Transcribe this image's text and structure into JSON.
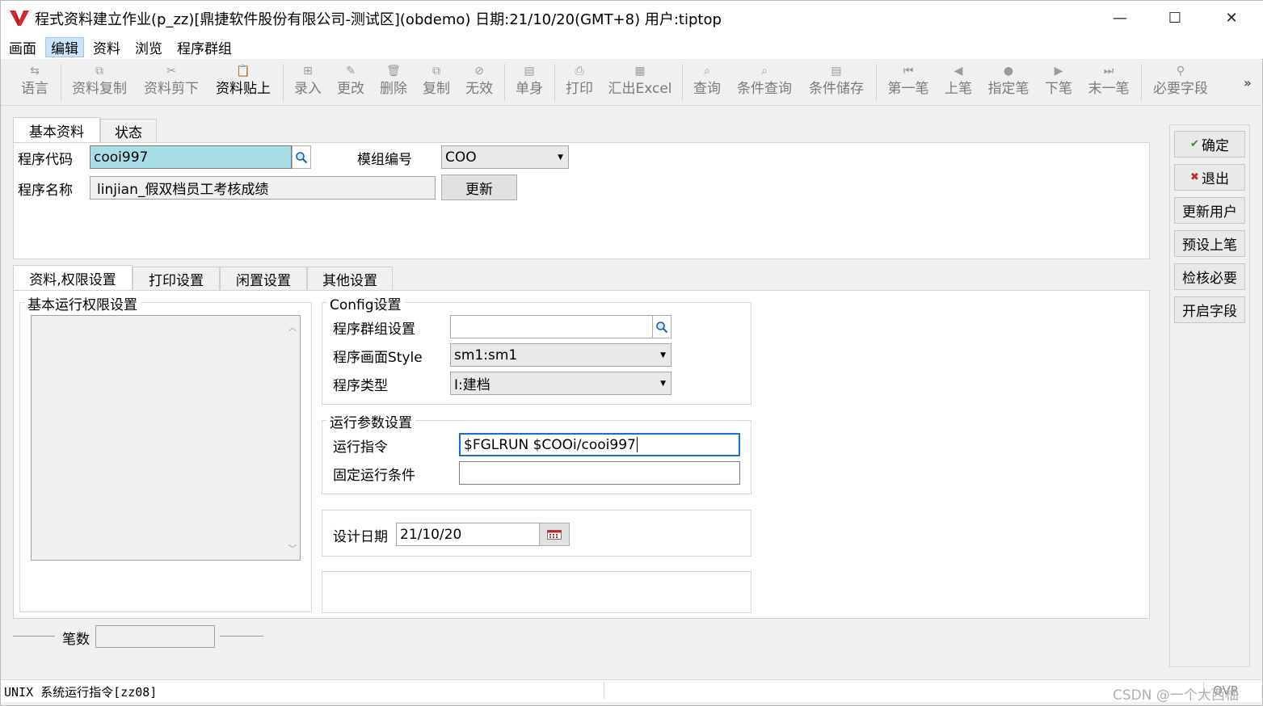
{
  "window": {
    "title": "程式资料建立作业(p_zz)[鼎捷软件股份有限公司-测试区](obdemo)  日期:21/10/20(GMT+8)  用户:tiptop",
    "minimize_glyph": "—",
    "maximize_glyph": "☐",
    "close_glyph": "✕"
  },
  "menu": [
    "画面",
    "编辑",
    "资料",
    "浏览",
    "程序群组"
  ],
  "toolbar": {
    "items": [
      {
        "label": "语言",
        "icon": "⇆"
      },
      {
        "label": "资料复制",
        "icon": "⧉"
      },
      {
        "label": "资料剪下",
        "icon": "✂"
      },
      {
        "label": "资料贴上",
        "icon": "📋"
      },
      {
        "label": "录入",
        "icon": "⊞"
      },
      {
        "label": "更改",
        "icon": "✎"
      },
      {
        "label": "删除",
        "icon": "🗑"
      },
      {
        "label": "复制",
        "icon": "⧉"
      },
      {
        "label": "无效",
        "icon": "⊘"
      },
      {
        "label": "单身",
        "icon": "▤"
      },
      {
        "label": "打印",
        "icon": "⎙"
      },
      {
        "label": "汇出Excel",
        "icon": "▦"
      },
      {
        "label": "查询",
        "icon": "⌕"
      },
      {
        "label": "条件查询",
        "icon": "⌕"
      },
      {
        "label": "条件储存",
        "icon": "▤"
      },
      {
        "label": "第一笔",
        "icon": "⏮"
      },
      {
        "label": "上笔",
        "icon": "◀"
      },
      {
        "label": "指定笔",
        "icon": "●"
      },
      {
        "label": "下笔",
        "icon": "▶"
      },
      {
        "label": "末一笔",
        "icon": "⏭"
      },
      {
        "label": "必要字段",
        "icon": "⚲"
      }
    ],
    "overflow": "»"
  },
  "top_tabs": [
    "基本资料",
    "状态"
  ],
  "basic": {
    "prog_code_label": "程序代码",
    "prog_code_value": "cooi997",
    "module_label": "模组编号",
    "module_value": "COO",
    "prog_name_label": "程序名称",
    "prog_name_value": "linjian_假双档员工考核成绩",
    "update_button": "更新"
  },
  "bottom_tabs": [
    "资料,权限设置",
    "打印设置",
    "闲置设置",
    "其他设置"
  ],
  "permissions": {
    "title": "基本运行权限设置"
  },
  "config": {
    "title": "Config设置",
    "group_label": "程序群组设置",
    "group_value": "",
    "style_label": "程序画面Style",
    "style_value": "sm1:sm1",
    "type_label": "程序类型",
    "type_value": "I:建档"
  },
  "run": {
    "title": "运行参数设置",
    "cmd_label": "运行指令",
    "cmd_value": "$FGLRUN $COOi/cooi997",
    "cond_label": "固定运行条件",
    "cond_value": ""
  },
  "design": {
    "label": "设计日期",
    "value": "21/10/20"
  },
  "count": {
    "label": "笔数",
    "value": ""
  },
  "side_buttons": [
    {
      "label": "确定",
      "icon": "✔"
    },
    {
      "label": "退出",
      "icon": "✖"
    },
    {
      "label": "更新用户",
      "icon": ""
    },
    {
      "label": "预设上笔",
      "icon": ""
    },
    {
      "label": "检核必要",
      "icon": ""
    },
    {
      "label": "开启字段",
      "icon": ""
    }
  ],
  "status": {
    "message": "UNIX 系统运行指令[zz08]",
    "mode": "OVR",
    "watermark": "CSDN @一个大西柚"
  },
  "colors": {
    "accent_cyan": "#a8dfe6",
    "logo_red": "#d9272e"
  }
}
